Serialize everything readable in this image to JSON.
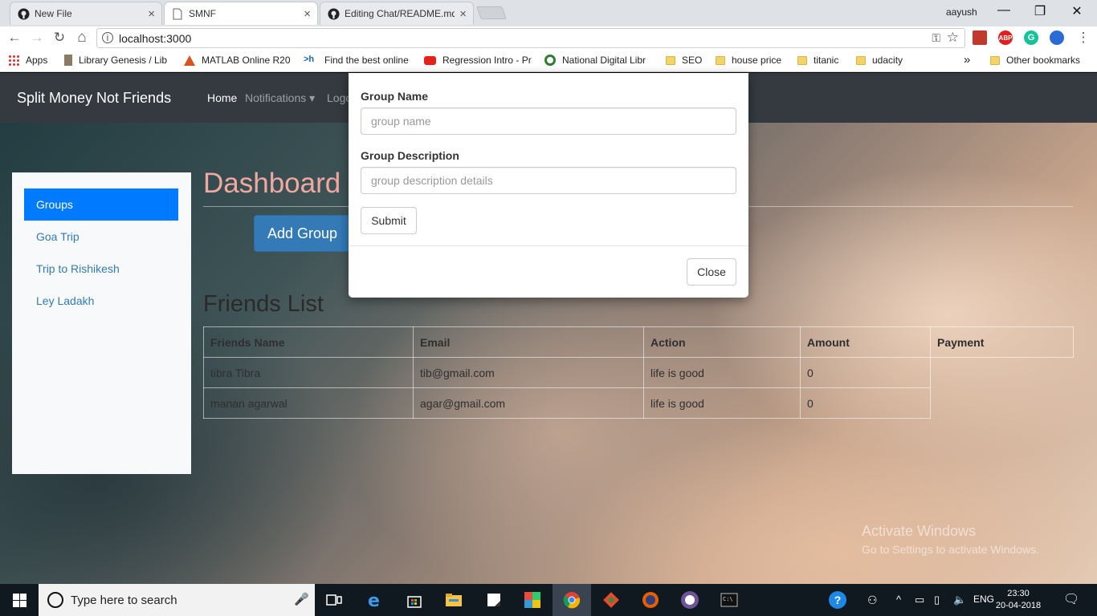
{
  "browser": {
    "tabs": [
      {
        "title": "New File",
        "close": "×"
      },
      {
        "title": "SMNF",
        "close": "×"
      },
      {
        "title": "Editing Chat/README.md",
        "close": "×"
      }
    ],
    "user": "aayush",
    "window_controls": {
      "minimize": "—",
      "restore": "❐",
      "close": "✕"
    },
    "nav": {
      "back": "←",
      "forward": "→",
      "reload": "↻",
      "home": "⌂"
    },
    "url": "localhost:3000",
    "info_glyph": "i",
    "key_glyph": "⚿",
    "star_glyph": "☆",
    "menu_glyph": "⋮",
    "extensions": [
      {
        "label": "",
        "color": "#c0392b"
      },
      {
        "label": "ABP",
        "color": "#e0201e"
      },
      {
        "label": "G",
        "color": "#15c39a"
      },
      {
        "label": "",
        "color": "#2b6bd6"
      }
    ],
    "bookmarks": [
      {
        "label": "Apps",
        "icon": "apps-icon"
      },
      {
        "label": "Library Genesis / Lib",
        "icon": "book-icon"
      },
      {
        "label": "MATLAB Online R20",
        "icon": "matlab-icon"
      },
      {
        "label": "Find the best online",
        "icon": "terminal-icon"
      },
      {
        "label": "Regression Intro - Pr",
        "icon": "youtube-icon"
      },
      {
        "label": "National Digital Libr",
        "icon": "ndl-icon"
      },
      {
        "label": "SEO",
        "icon": "folder-icon"
      },
      {
        "label": "house price",
        "icon": "folder-icon"
      },
      {
        "label": "titanic",
        "icon": "folder-icon"
      },
      {
        "label": "udacity",
        "icon": "folder-icon"
      }
    ],
    "overflow": "»",
    "other_bookmarks": "Other bookmarks"
  },
  "navbar": {
    "brand": "Split Money Not Friends",
    "links": [
      {
        "label": "Home"
      },
      {
        "label": "Notifications ▾"
      },
      {
        "label": "Logo"
      }
    ]
  },
  "sidebar": {
    "items": [
      {
        "label": "Groups",
        "active": true
      },
      {
        "label": "Goa Trip"
      },
      {
        "label": "Trip to Rishikesh"
      },
      {
        "label": "Ley Ladakh"
      }
    ]
  },
  "main": {
    "title": "Dashboard",
    "add_group_label": "Add Group",
    "friends_title": "Friends List",
    "table": {
      "headers": [
        "Friends Name",
        "Email",
        "Action",
        "Amount",
        "Payment"
      ],
      "rows": [
        [
          "tibra Tibra",
          "tib@gmail.com",
          "life is good",
          "0"
        ],
        [
          "manan agarwal",
          "agar@gmail.com",
          "life is good",
          "0"
        ]
      ]
    }
  },
  "modal": {
    "group_name_label": "Group Name",
    "group_name_placeholder": "group name",
    "group_desc_label": "Group Description",
    "group_desc_placeholder": "group description details",
    "submit_label": "Submit",
    "close_label": "Close"
  },
  "watermark": {
    "line1": "Activate Windows",
    "line2": "Go to Settings to activate Windows."
  },
  "taskbar": {
    "search_placeholder": "Type here to search",
    "mic_glyph": "🎤",
    "tray": {
      "help": "?",
      "people": "⚇",
      "chevron": "^",
      "battery": "▭",
      "network": "▯",
      "volume": "🔈",
      "language": "ENG"
    },
    "time": "23:30",
    "date": "20-04-2018",
    "notification_glyph": "🗨"
  },
  "colors": {
    "navbar_bg": "#343a40",
    "active_sidebar": "#007bff",
    "add_group_btn": "#337ab7",
    "dashboard_title": "#f0a8a0"
  }
}
